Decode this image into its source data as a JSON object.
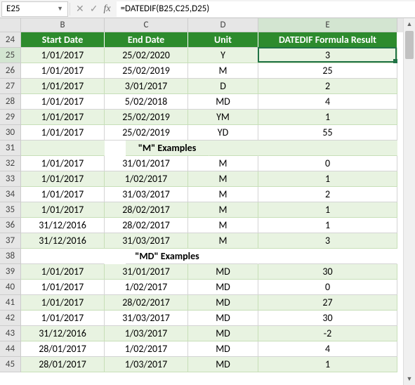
{
  "name_box": "E25",
  "formula": "=DATEDIF(B25,C25,D25)",
  "column_labels": {
    "b": "B",
    "c": "C",
    "d": "D",
    "e": "E"
  },
  "row_numbers": [
    "24",
    "25",
    "26",
    "27",
    "28",
    "29",
    "30",
    "31",
    "32",
    "33",
    "34",
    "35",
    "36",
    "37",
    "38",
    "39",
    "40",
    "41",
    "42",
    "43",
    "44",
    "45"
  ],
  "selected_col": "E",
  "selected_row": "25",
  "chart_data": {
    "type": "table",
    "title": "DATEDIF Formula Result",
    "columns": [
      "Start Date",
      "End Date",
      "Unit",
      "DATEDIF Formula Result"
    ],
    "rows": [
      {
        "start": "1/01/2017",
        "end": "25/02/2020",
        "unit": "Y",
        "result": "3",
        "stripe": true
      },
      {
        "start": "1/01/2017",
        "end": "25/02/2019",
        "unit": "M",
        "result": "25",
        "stripe": false
      },
      {
        "start": "1/01/2017",
        "end": "3/01/2017",
        "unit": "D",
        "result": "2",
        "stripe": true
      },
      {
        "start": "1/01/2017",
        "end": "5/02/2018",
        "unit": "MD",
        "result": "4",
        "stripe": false
      },
      {
        "start": "1/01/2017",
        "end": "25/02/2019",
        "unit": "YM",
        "result": "1",
        "stripe": true
      },
      {
        "start": "1/01/2017",
        "end": "25/02/2019",
        "unit": "YD",
        "result": "55",
        "stripe": false
      },
      {
        "section": "\"M\" Examples",
        "stripe": true
      },
      {
        "start": "1/01/2017",
        "end": "31/01/2017",
        "unit": "M",
        "result": "0",
        "stripe": false
      },
      {
        "start": "1/01/2017",
        "end": "1/02/2017",
        "unit": "M",
        "result": "1",
        "stripe": true
      },
      {
        "start": "1/01/2017",
        "end": "31/03/2017",
        "unit": "M",
        "result": "2",
        "stripe": false
      },
      {
        "start": "1/01/2017",
        "end": "28/02/2017",
        "unit": "M",
        "result": "1",
        "stripe": true
      },
      {
        "start": "31/12/2016",
        "end": "28/02/2017",
        "unit": "M",
        "result": "1",
        "stripe": false
      },
      {
        "start": "31/12/2016",
        "end": "31/03/2017",
        "unit": "M",
        "result": "3",
        "stripe": true
      },
      {
        "section": "\"MD\" Examples",
        "stripe": false
      },
      {
        "start": "1/01/2017",
        "end": "31/01/2017",
        "unit": "MD",
        "result": "30",
        "stripe": true
      },
      {
        "start": "1/01/2017",
        "end": "1/02/2017",
        "unit": "MD",
        "result": "0",
        "stripe": false
      },
      {
        "start": "1/01/2017",
        "end": "28/02/2017",
        "unit": "MD",
        "result": "27",
        "stripe": true
      },
      {
        "start": "1/01/2017",
        "end": "31/03/2017",
        "unit": "MD",
        "result": "30",
        "stripe": false
      },
      {
        "start": "31/12/2016",
        "end": "1/03/2017",
        "unit": "MD",
        "result": "-2",
        "stripe": true
      },
      {
        "start": "28/01/2017",
        "end": "1/02/2017",
        "unit": "MD",
        "result": "4",
        "stripe": false
      },
      {
        "start": "28/01/2017",
        "end": "1/03/2017",
        "unit": "MD",
        "result": "1",
        "stripe": true
      }
    ]
  }
}
